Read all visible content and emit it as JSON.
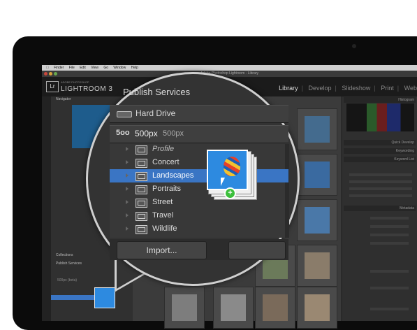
{
  "menubar": {
    "items": [
      "Finder",
      "File",
      "Edit",
      "View",
      "Go",
      "Window",
      "Help"
    ]
  },
  "window": {
    "title": "Adobe Photoshop Lightroom - Library"
  },
  "app": {
    "badge": "Lr",
    "subtitle": "ADOBE PHOTOSHOP",
    "name": "LIGHTROOM 3"
  },
  "modules": {
    "items": [
      "Library",
      "Develop",
      "Slideshow",
      "Print",
      "Web"
    ],
    "active": "Library"
  },
  "left_panel": {
    "navigator": "Navigator",
    "collections": "Collections",
    "publish_services": "Publish Services",
    "mini_service": "500px (beta)"
  },
  "right_panel": {
    "histogram": "Histogram",
    "quick_develop": "Quick Develop",
    "keywording": "Keywording",
    "keyword_list": "Keyword List",
    "metadata": "Metadata"
  },
  "publish_panel": {
    "title": "Publish Services",
    "hard_drive_label": "Hard Drive",
    "service_logo": "5oo",
    "service_name": "500px",
    "service_account": "500px",
    "collections": [
      {
        "label": "Profile",
        "italic": true
      },
      {
        "label": "Concert"
      },
      {
        "label": "Landscapes",
        "selected": true
      },
      {
        "label": "Portraits"
      },
      {
        "label": "Street"
      },
      {
        "label": "Travel"
      },
      {
        "label": "Wildlife"
      }
    ],
    "import_label": "Import...",
    "export_label": ""
  },
  "drag": {
    "badge": "+"
  },
  "colors": {
    "selection": "#3a75c4",
    "panel_bg": "#383838",
    "badge_green": "#3cbf3c"
  }
}
